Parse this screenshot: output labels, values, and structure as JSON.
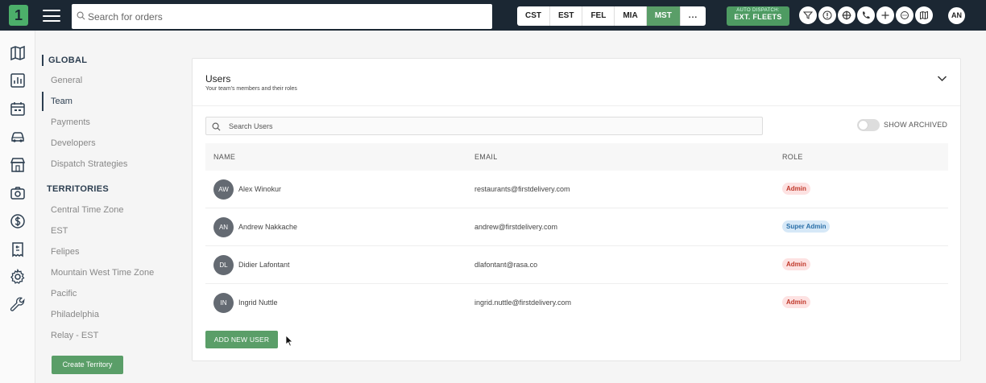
{
  "header": {
    "logo_text": "1",
    "search_placeholder": "Search for orders",
    "timezones": [
      "CST",
      "EST",
      "FEL",
      "MIA",
      "MST"
    ],
    "active_timezone": "MST",
    "more_label": "...",
    "dispatch_top": "AUTO DISPATCH:",
    "dispatch_bottom": "EXT. FLEETS",
    "icons": [
      "filter-icon",
      "info-icon",
      "radar-icon",
      "phone-icon",
      "plus-icon",
      "chat-icon",
      "map-icon"
    ],
    "user_initials": "AN"
  },
  "rail": {
    "icons": [
      "map-icon",
      "chart-icon",
      "calendar-icon",
      "car-icon",
      "store-icon",
      "camera-icon",
      "dollar-icon",
      "receipt-icon",
      "settings-icon",
      "wrench-icon"
    ]
  },
  "nav": {
    "global_heading": "GLOBAL",
    "global_items": [
      "General",
      "Team",
      "Payments",
      "Developers",
      "Dispatch Strategies"
    ],
    "active_item": "Team",
    "territories_heading": "TERRITORIES",
    "territory_items": [
      "Central Time Zone",
      "EST",
      "Felipes",
      "Mountain West Time Zone",
      "Pacific",
      "Philadelphia",
      "Relay - EST"
    ],
    "create_button": "Create Territory"
  },
  "card": {
    "title": "Users",
    "subtitle": "Your team's members and their roles",
    "search_placeholder": "Search Users",
    "show_archived_label": "SHOW ARCHIVED",
    "show_archived": false,
    "columns": [
      "NAME",
      "EMAIL",
      "ROLE"
    ],
    "users": [
      {
        "initials": "AW",
        "name": "Alex Winokur",
        "email": "restaurants@firstdelivery.com",
        "role": "Admin"
      },
      {
        "initials": "AN",
        "name": "Andrew Nakkache",
        "email": "andrew@firstdelivery.com",
        "role": "Super Admin"
      },
      {
        "initials": "DL",
        "name": "Didier Lafontant",
        "email": "dlafontant@rasa.co",
        "role": "Admin"
      },
      {
        "initials": "IN",
        "name": "Ingrid Nuttle",
        "email": "ingrid.nuttle@firstdelivery.com",
        "role": "Admin"
      }
    ],
    "add_button": "ADD NEW USER"
  }
}
